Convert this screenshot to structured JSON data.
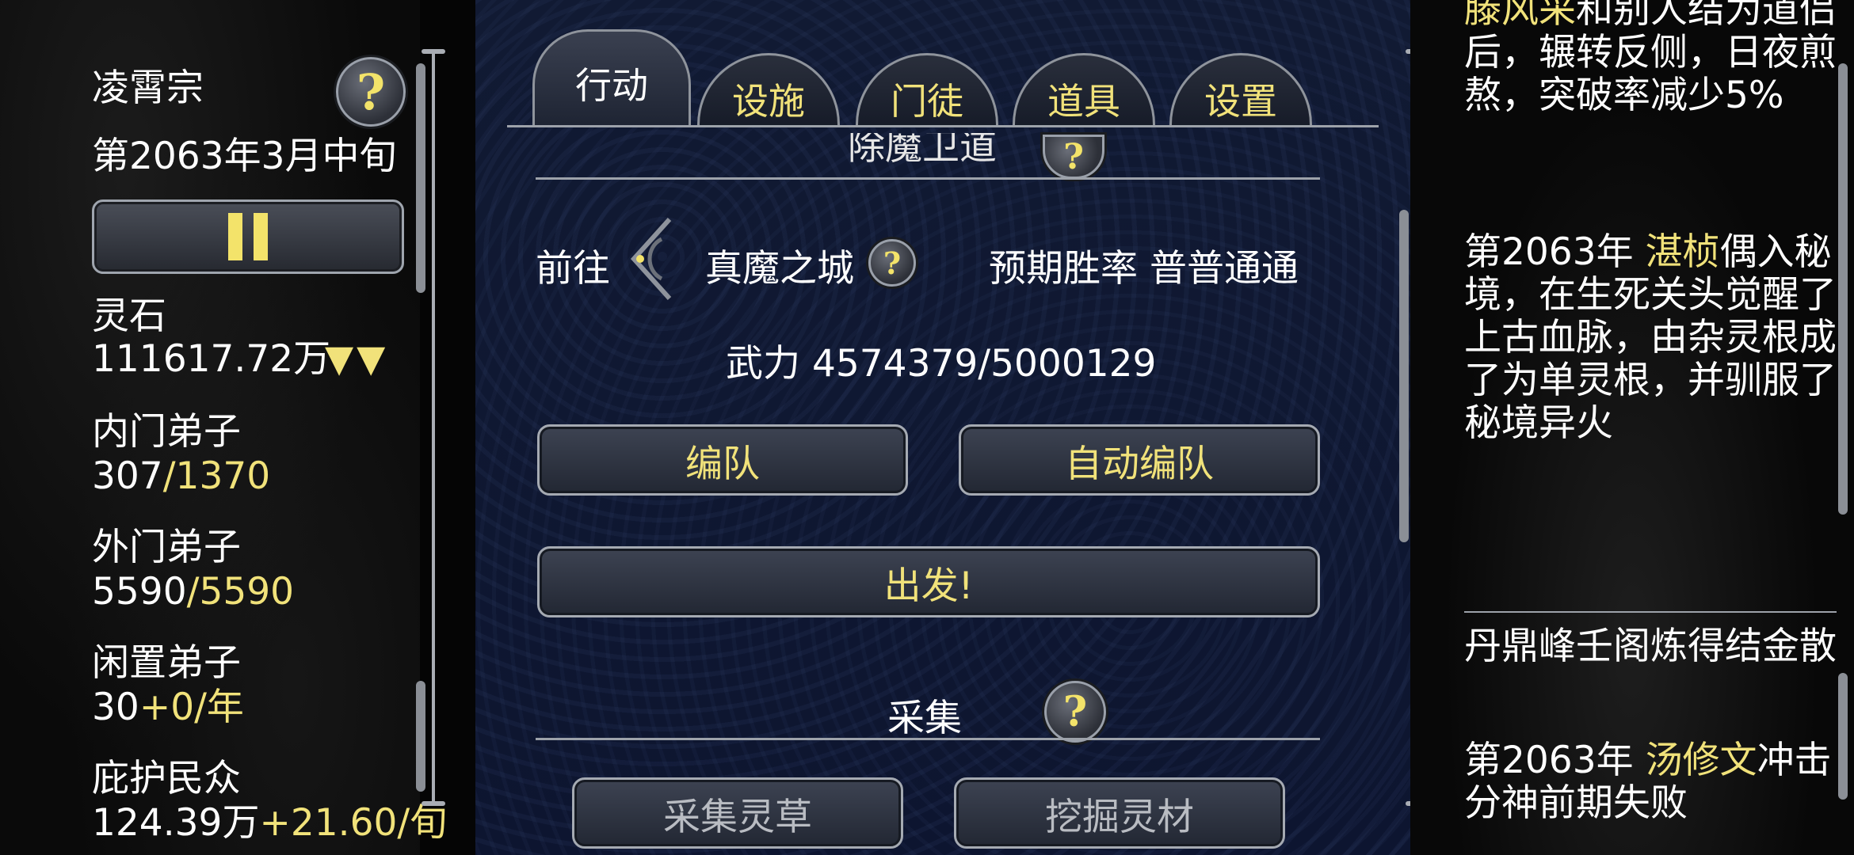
{
  "left_panel": {
    "sect_name": "凌霄宗",
    "date": "第2063年3月中旬",
    "stats": [
      {
        "label": "灵石",
        "value": "111617.72万",
        "trend": "▼▼"
      },
      {
        "label": "内门弟子",
        "value": "307",
        "capacity": "/1370"
      },
      {
        "label": "外门弟子",
        "value": "5590",
        "capacity": "/5590"
      },
      {
        "label": "闲置弟子",
        "value": "30",
        "rate": "+0/年"
      },
      {
        "label": "庇护民众",
        "value": "124.39万",
        "rate": "+21.60/旬"
      }
    ]
  },
  "tabs": [
    {
      "label": "行动",
      "active": true
    },
    {
      "label": "设施",
      "active": false
    },
    {
      "label": "门徒",
      "active": false
    },
    {
      "label": "道具",
      "active": false
    },
    {
      "label": "设置",
      "active": false
    }
  ],
  "action_panel": {
    "section_title_partial": "除魔卫道",
    "goto_label": "前往",
    "destination": "真魔之城",
    "expected_rate_label": "预期胜率",
    "expected_rate_value": "普普通通",
    "force_label": "武力",
    "force_value": "4574379/5000129",
    "form_team_label": "编队",
    "auto_team_label": "自动编队",
    "depart_label": "出发!",
    "gather_section_title": "采集",
    "gather_herb_label": "采集灵草",
    "dig_material_label": "挖掘灵材"
  },
  "log_panel": {
    "entries": [
      {
        "prefix": "",
        "name": "滕风采",
        "text": "和别人结为道侣后，辗转反侧，日夜煎熬，突破率减少5%"
      },
      {
        "prefix": "第2063年 ",
        "name": "湛桢",
        "text": "偶入秘境，在生死关头觉醒了上古血脉，由杂灵根成了为单灵根，并驯服了秘境异火"
      },
      {
        "prefix": "",
        "name": "",
        "text": "丹鼎峰壬阁炼得结金散"
      },
      {
        "prefix": "第2063年 ",
        "name": "汤修文",
        "text": "冲击分神前期失败"
      }
    ]
  },
  "colors": {
    "accent_yellow": "#f1e27a",
    "panel_navy": "#111a33",
    "border_silver": "#9da2aa"
  },
  "icons": {
    "help": "question-mark-icon",
    "pause": "pause-icon",
    "goto": "ornate-arrow-icon"
  }
}
